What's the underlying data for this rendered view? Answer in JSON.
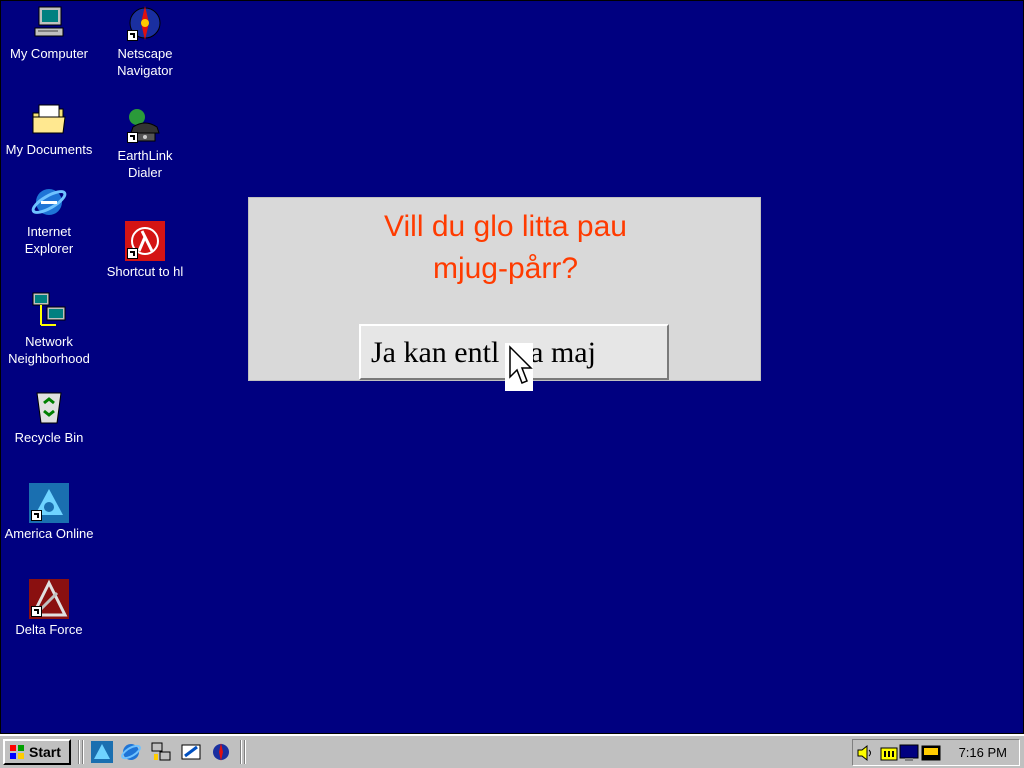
{
  "desktop": {
    "background": "#000080",
    "icons": [
      {
        "label": "My Computer",
        "icon": "my-computer-icon",
        "shortcut": false
      },
      {
        "label": "Netscape\nNavigator",
        "icon": "netscape-navigator-icon",
        "shortcut": true
      },
      {
        "label": "My Documents",
        "icon": "my-documents-folder-icon",
        "shortcut": false
      },
      {
        "label": "EarthLink\nDialer",
        "icon": "earthlink-dialer-phone-icon",
        "shortcut": true
      },
      {
        "label": "Internet\nExplorer",
        "icon": "internet-explorer-icon",
        "shortcut": false
      },
      {
        "label": "Shortcut to hl",
        "icon": "half-life-lambda-icon",
        "shortcut": true
      },
      {
        "label": "Network\nNeighborhood",
        "icon": "network-neighborhood-icon",
        "shortcut": false
      },
      {
        "label": "Recycle Bin",
        "icon": "recycle-bin-icon",
        "shortcut": false
      },
      {
        "label": "America Online",
        "icon": "america-online-icon",
        "shortcut": true
      },
      {
        "label": "Delta Force",
        "icon": "delta-force-icon",
        "shortcut": true
      }
    ]
  },
  "dialog": {
    "question_line1": "Vill du glo litta pau",
    "question_line2": "mjug-pårr?",
    "button_label": "Ja kan entl  tya maj",
    "question_color": "#ff3b00"
  },
  "taskbar": {
    "start_label": "Start",
    "quick_launch": [
      "aol-icon",
      "internet-explorer-icon",
      "network-icon",
      "channel-guide-icon",
      "netscape-icon"
    ],
    "tray_icons": [
      "volume-speaker-icon",
      "battery-meter-icon",
      "monitor-icon",
      "display-properties-icon"
    ],
    "clock": "7:16 PM"
  }
}
